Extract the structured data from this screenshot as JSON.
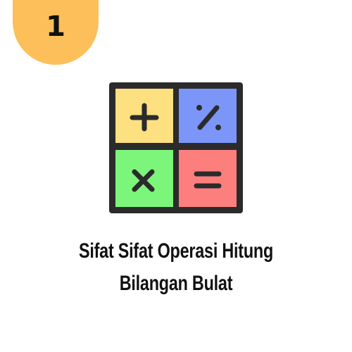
{
  "badge": {
    "number": "1",
    "color": "#fdbf5a"
  },
  "icon": {
    "name": "calculator-operations-icon",
    "colors": {
      "plus_tile": "#fde07f",
      "percent_tile": "#7b96f8",
      "times_tile": "#7cf57b",
      "equals_tile": "#fc7f7e",
      "outline": "#2b2b2b"
    }
  },
  "title": {
    "line1": "Sifat Sifat Operasi Hitung",
    "line2": "Bilangan Bulat"
  }
}
